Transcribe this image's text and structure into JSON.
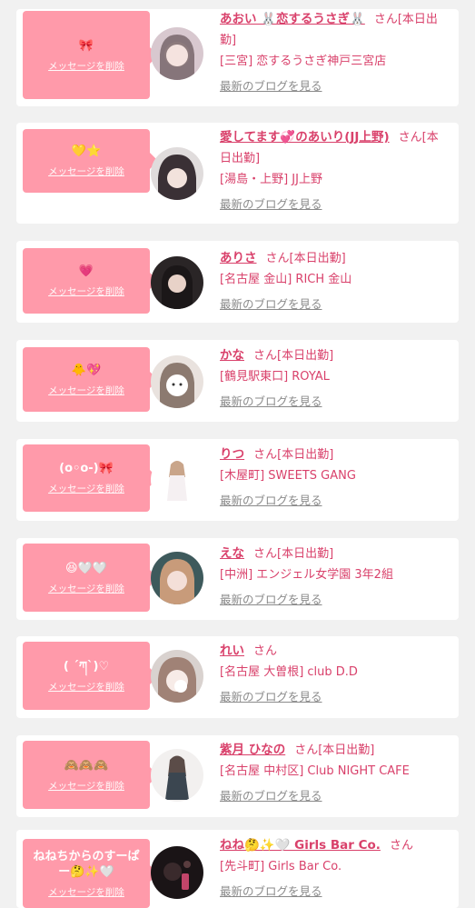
{
  "common": {
    "delete_label": "メッセージを削除",
    "blog_label": "最新のブログを見る"
  },
  "colors": {
    "background": "#f1f1f1",
    "bubble": "#ff9aaa",
    "text_accent": "#d9416b",
    "muted": "#8a8a8a"
  },
  "messages": [
    {
      "message": "🎀",
      "name": "あおい 🐰恋するうさぎ🐰",
      "suffix": "さん[本日出勤]",
      "shop": "[三宮] 恋するうさぎ神戸三宮店"
    },
    {
      "message": "💛⭐",
      "name": "愛してます💞のあいり(JJ上野)",
      "suffix": "さん[本日出勤]",
      "shop": "[湯島・上野] JJ上野"
    },
    {
      "message": "💗",
      "name": "ありさ",
      "suffix": "さん[本日出勤]",
      "shop": "[名古屋 金山] RICH 金山"
    },
    {
      "message": "🐥💖",
      "name": "かな",
      "suffix": "さん[本日出勤]",
      "shop": "[鶴見駅東口] ROYAL"
    },
    {
      "message": "(o◦o-)🎀",
      "name": "りつ",
      "suffix": "さん[本日出勤]",
      "shop": "[木屋町] SWEETS GANG"
    },
    {
      "message": "😆🤍🤍",
      "name": "えな",
      "suffix": "さん[本日出勤]",
      "shop": "[中洲] エンジェル女学園 3年2組"
    },
    {
      "message": "( ´ཀ`)♡",
      "name": "れい",
      "suffix": "さん",
      "shop": "[名古屋 大曽根] club D.D"
    },
    {
      "message": "🙈🙈🙈",
      "name": "紫月 ひなの",
      "suffix": "さん[本日出勤]",
      "shop": "[名古屋 中村区] Club NIGHT CAFE"
    },
    {
      "message": "ねねちからのすーぱー🤔✨🤍",
      "name": "ねね🤔✨🤍 Girls Bar Co.",
      "suffix": "さん",
      "shop": "[先斗町] Girls Bar Co."
    }
  ]
}
